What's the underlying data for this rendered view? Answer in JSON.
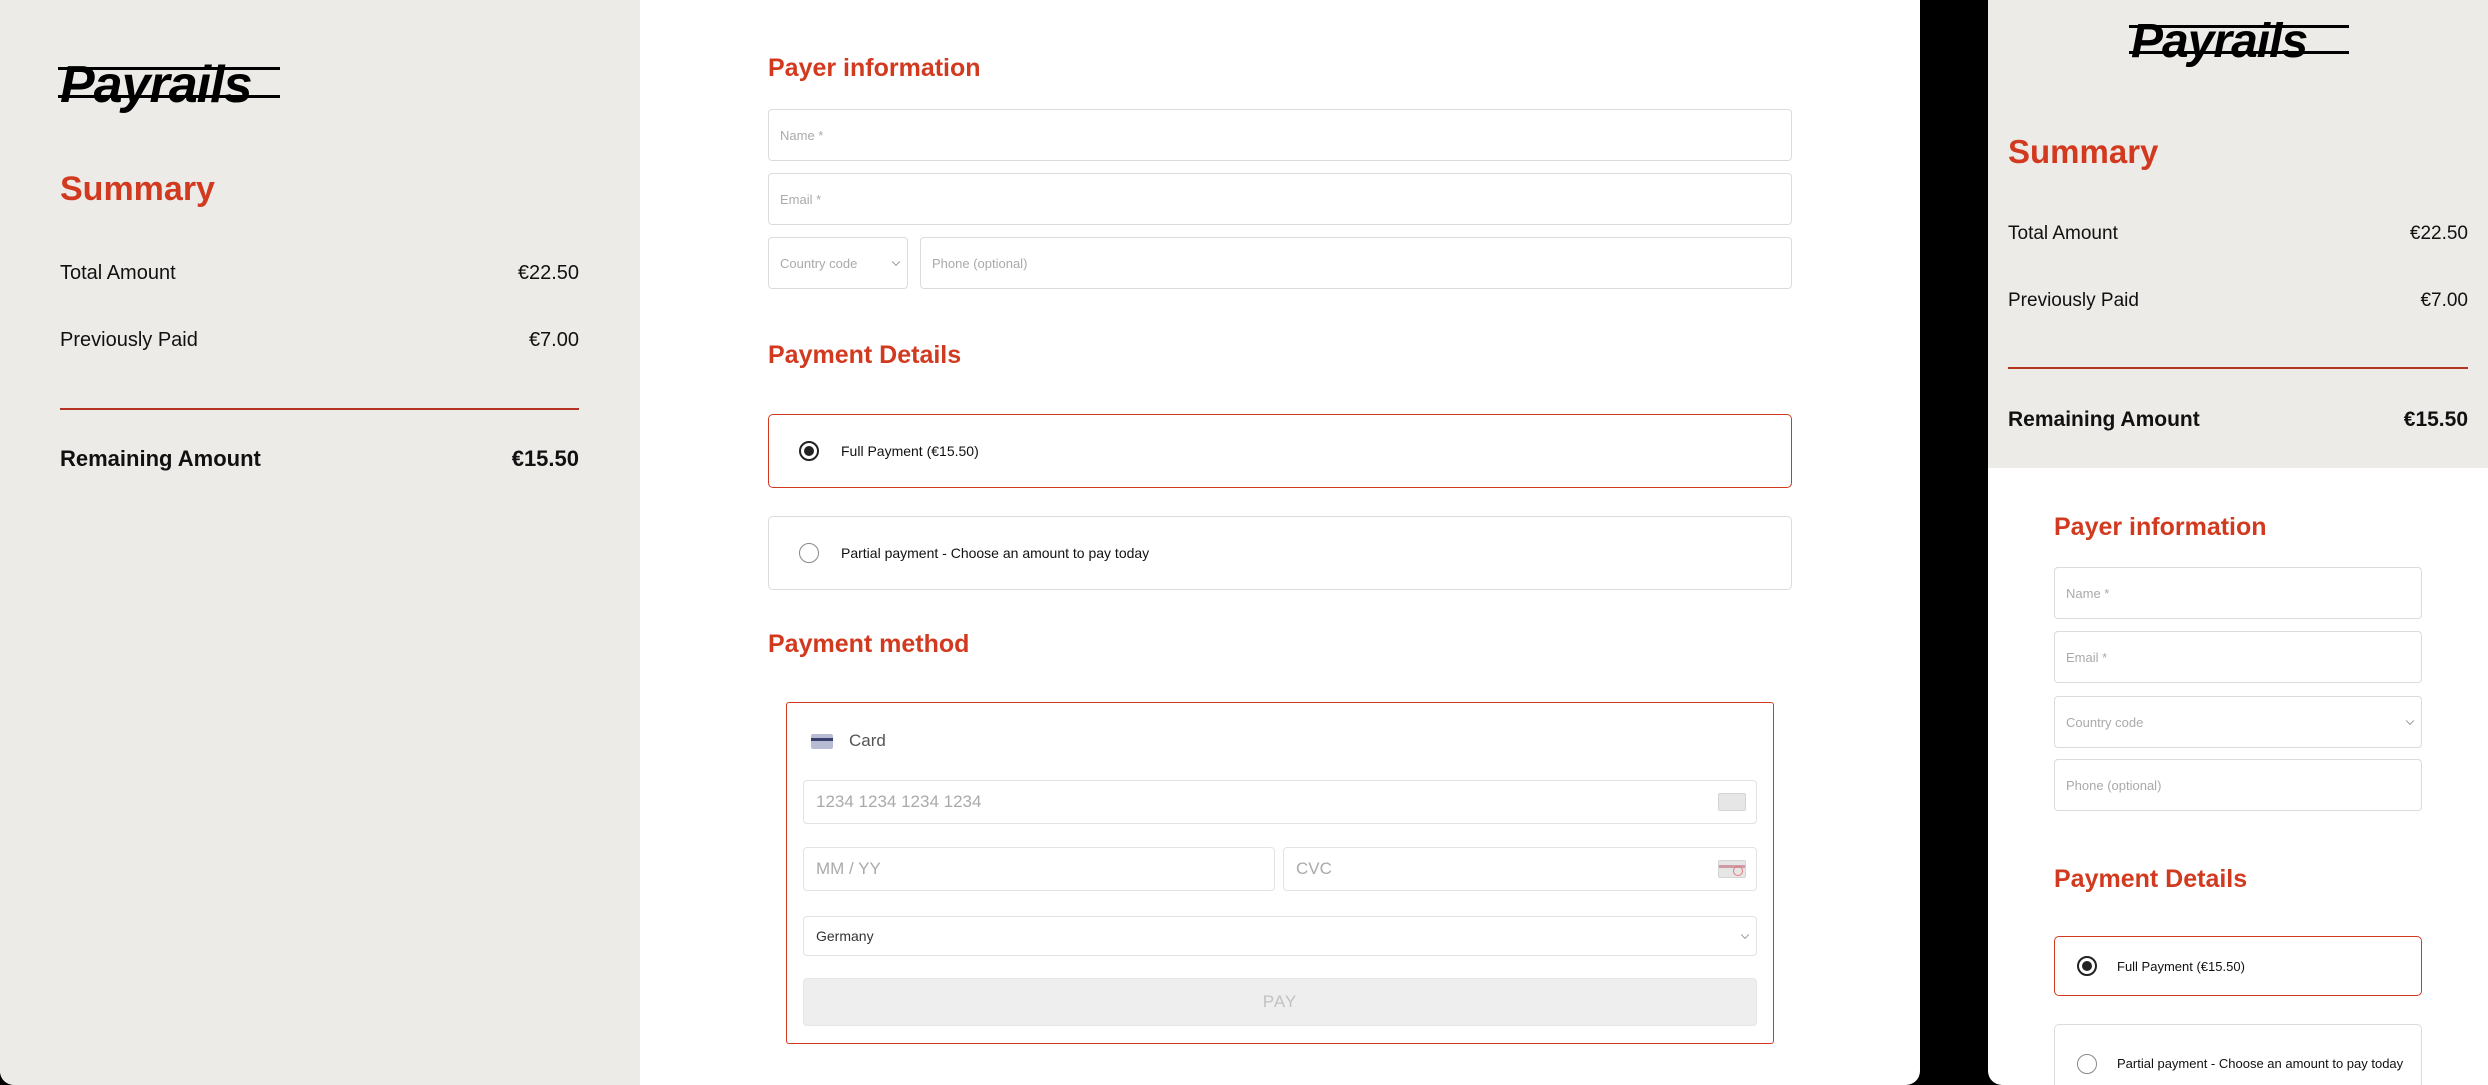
{
  "brand": {
    "logo_text": "Payrails",
    "accent_color": "#d23a1f"
  },
  "summary": {
    "title": "Summary",
    "total_label": "Total Amount",
    "total_value": "€22.50",
    "paid_label": "Previously Paid",
    "paid_value": "€7.00",
    "remaining_label": "Remaining Amount",
    "remaining_value": "€15.50"
  },
  "payer": {
    "title": "Payer information",
    "name_placeholder": "Name *",
    "email_placeholder": "Email *",
    "country_placeholder": "Country code",
    "phone_placeholder": "Phone (optional)"
  },
  "details": {
    "title": "Payment Details",
    "full_label": "Full Payment (€15.50)",
    "partial_label": "Partial payment - Choose an amount to pay today"
  },
  "method": {
    "title": "Payment method",
    "card_label": "Card",
    "card_number_placeholder": "1234 1234 1234 1234",
    "expiry_placeholder": "MM / YY",
    "cvc_placeholder": "CVC",
    "country_value": "Germany",
    "pay_label": "PAY"
  }
}
